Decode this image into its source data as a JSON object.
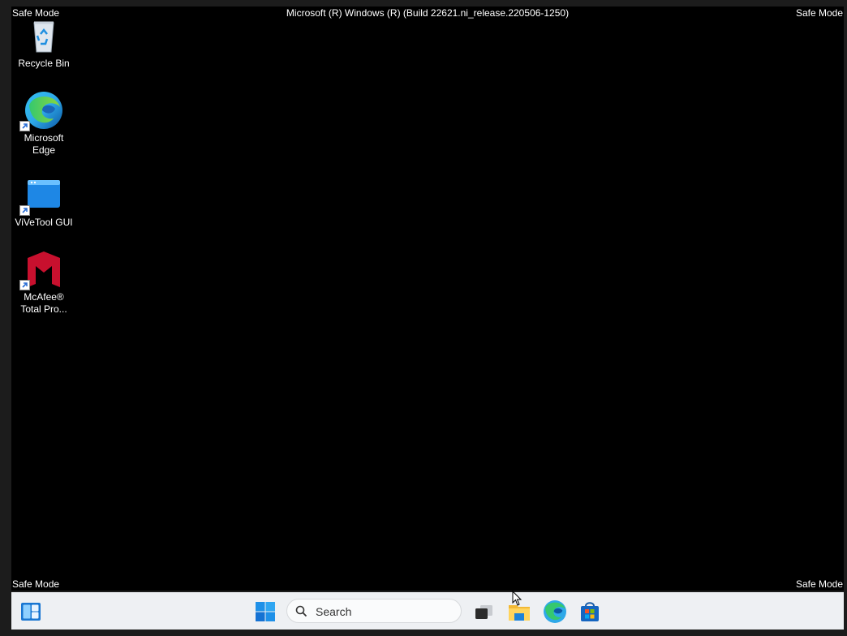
{
  "watermark": {
    "top_left": "Safe Mode",
    "top_right": "Safe Mode",
    "bottom_left": "Safe Mode",
    "bottom_right": "Safe Mode",
    "build": "Microsoft (R) Windows (R) (Build 22621.ni_release.220506-1250)"
  },
  "desktop": {
    "icons": [
      {
        "label": "Recycle Bin",
        "icon": "recycle-bin-icon"
      },
      {
        "label": "Microsoft Edge",
        "icon": "edge-icon"
      },
      {
        "label": "ViVeTool GUI",
        "icon": "vivetool-icon"
      },
      {
        "label": "McAfee® Total Pro...",
        "icon": "mcafee-icon"
      }
    ]
  },
  "taskbar": {
    "widgets_icon": "widgets-icon",
    "start_icon": "windows-start-icon",
    "search_placeholder": "Search",
    "pinned": [
      "task-view-icon",
      "file-explorer-icon",
      "edge-icon",
      "microsoft-store-icon"
    ]
  },
  "colors": {
    "desktop": "#000000",
    "taskbar": "#eef0f3",
    "start_blue": "#1e90e8"
  }
}
